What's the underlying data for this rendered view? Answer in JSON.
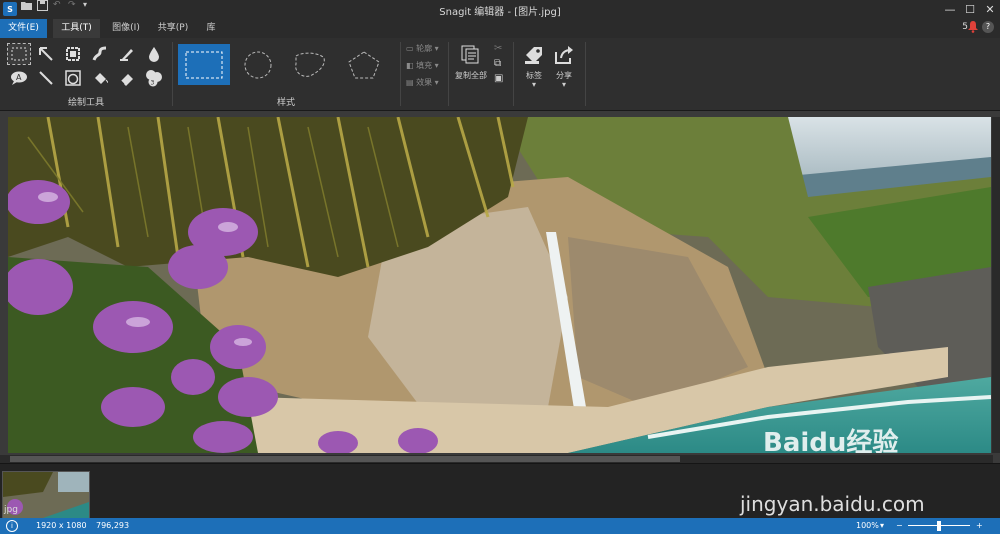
{
  "window": {
    "title": "Snagit 编辑器 - [图片.jpg]",
    "app_logo_text": "S",
    "controls": [
      "minimize",
      "maximize",
      "close"
    ]
  },
  "menu_tabs": [
    "文件(E)",
    "工具(T)",
    "图像(I)",
    "共享(P)",
    "库"
  ],
  "menu_right": {
    "notification_count": "5"
  },
  "ribbon": {
    "drawing_tools_label": "绘制工具",
    "styles_label": "样式",
    "style_options": [
      "轮廓",
      "填充",
      "效果"
    ],
    "copy_all_label": "复制全部",
    "tag_label": "标签",
    "share_label": "分享"
  },
  "tray": {
    "thumb_label": "jpg"
  },
  "status": {
    "dimensions": "1920 x 1080",
    "coords": "796,293",
    "zoom": "100%"
  },
  "watermark": {
    "brand": "Baidu经验",
    "url": "jingyan.baidu.com"
  },
  "colors": {
    "accent": "#1d6fb8",
    "ribbon": "#2f2f2f",
    "tray": "#232323"
  }
}
